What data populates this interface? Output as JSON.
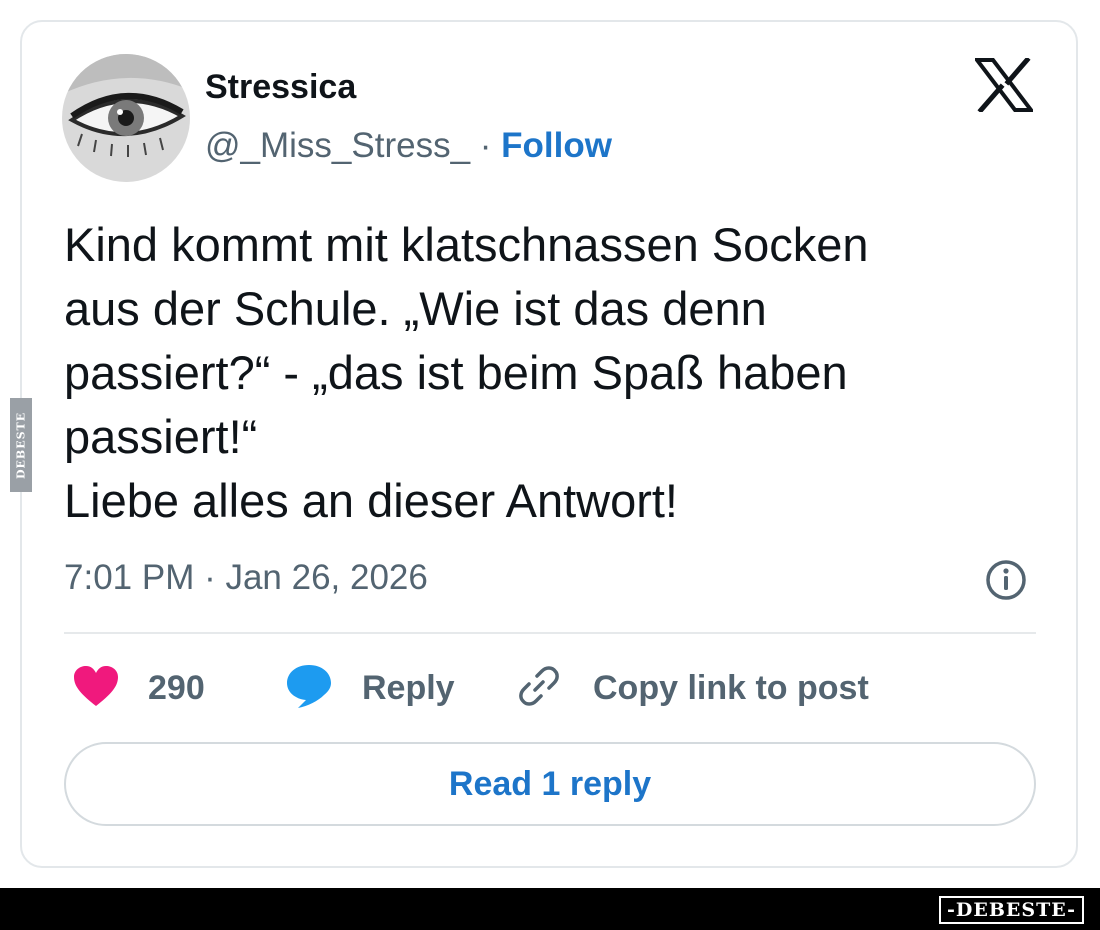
{
  "user": {
    "display_name": "Stressica",
    "handle": "@_Miss_Stress_",
    "separator": "·",
    "follow_label": "Follow"
  },
  "tweet": {
    "text": "Kind kommt mit klatschnassen Socken\naus der Schule. „Wie ist das denn\npassiert?“ - „das ist beim Spaß haben\npassiert!“\nLiebe alles an dieser Antwort!",
    "timestamp": "7:01 PM · Jan 26, 2026"
  },
  "actions": {
    "like_count": "290",
    "reply_label": "Reply",
    "copy_link_label": "Copy link to post",
    "read_reply_label": "Read 1 reply"
  },
  "watermark": {
    "side_text": "DEBESTE",
    "footer_text": "-DEBESTE-"
  },
  "colors": {
    "link_blue": "#1d75c9",
    "like_pink": "#f0197d",
    "reply_blue": "#1d9bf0",
    "muted_gray": "#536471"
  },
  "icons": {
    "logo": "x-logo-icon",
    "info": "info-icon",
    "like": "heart-icon",
    "reply": "speech-bubble-icon",
    "copy_link": "link-icon"
  }
}
